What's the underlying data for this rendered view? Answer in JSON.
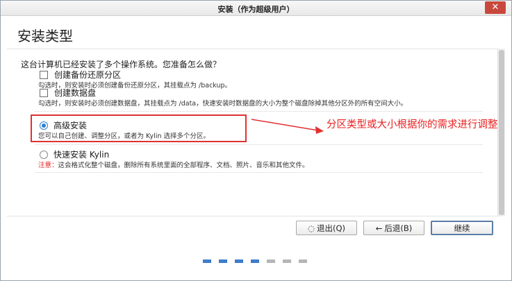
{
  "window": {
    "title": "安装（作为超级用户）",
    "close_glyph": "✕"
  },
  "page_title": "安装类型",
  "question": "这台计算机已经安装了多个操作系统。您准备怎么做？",
  "options": {
    "backup": {
      "label": "创建备份还原分区",
      "desc": "勾选时，则安装时必须创建备份还原分区，其挂载点为 /backup。"
    },
    "data": {
      "label": "创建数据盘",
      "desc": "勾选时，则安装时必须创建数据盘，其挂载点为 /data，快速安装时数据盘的大小为整个磁盘除掉其他分区外的所有空间大小。"
    },
    "advanced": {
      "label": "高级安装",
      "desc": "您可以自己创建、调整分区，或者为 Kylin 选择多个分区。",
      "selected": true
    },
    "quick": {
      "label": "快速安装 Kylin",
      "note_label": "注意：",
      "note": "这会格式化整个磁盘，删除所有系统里面的全部程序、文档、照片、音乐和其他文件。",
      "selected": false
    }
  },
  "annotation": "分区类型或大小根据你的需求进行调整",
  "buttons": {
    "quit": "退出(Q)",
    "quit_icon": "◌",
    "back": "后退(B)",
    "back_icon": "←",
    "continue": "继续"
  },
  "progress": {
    "total": 7,
    "completed": 4
  },
  "colors": {
    "accent": "#2a7fd4",
    "annotation": "#e82020",
    "close": "#c9483e"
  }
}
